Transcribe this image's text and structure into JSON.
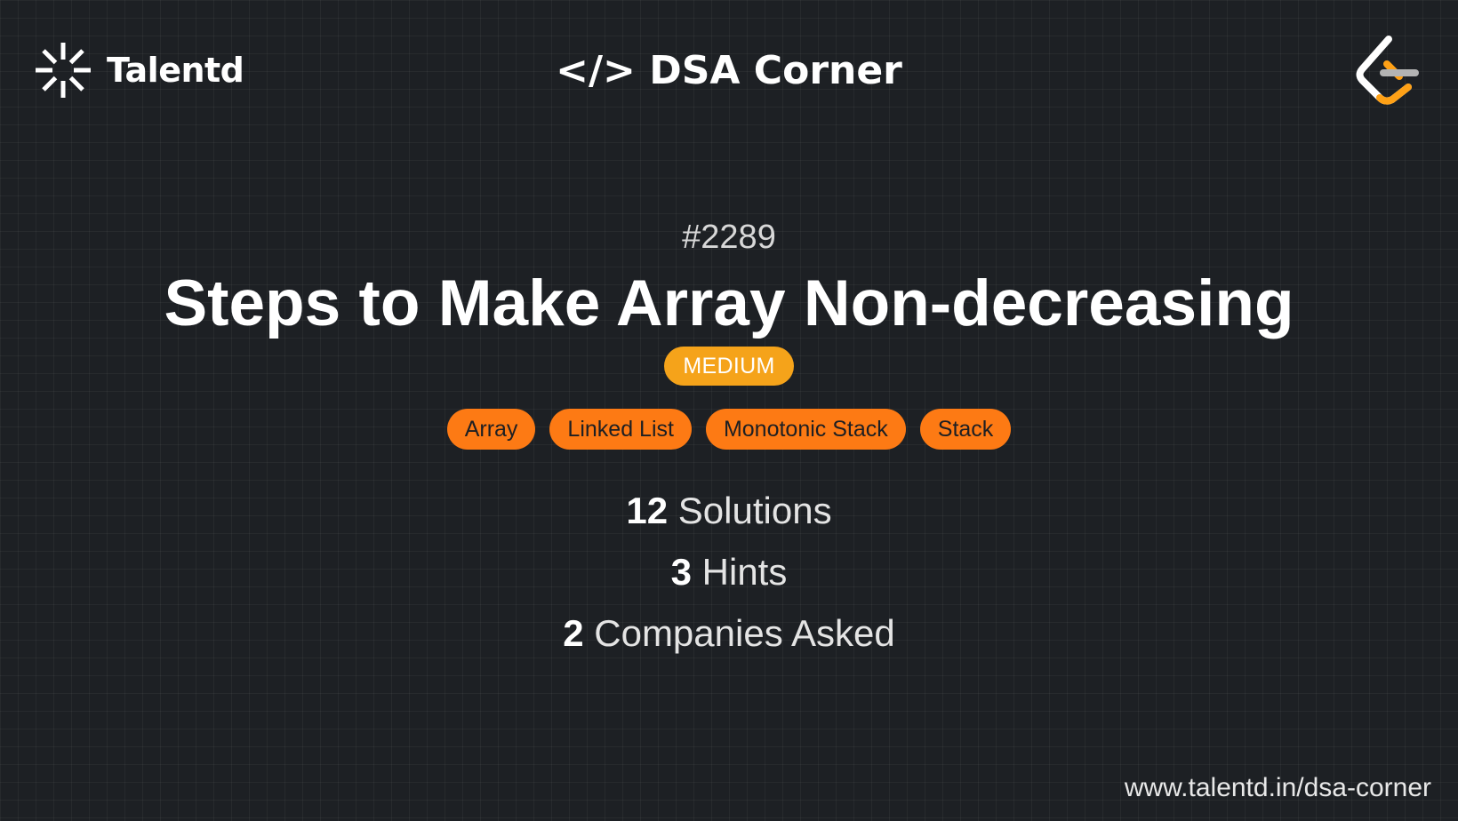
{
  "brand": {
    "name": "Talentd",
    "icon": "asterisk-burst-icon",
    "color": "#ffffff"
  },
  "header": {
    "section_title": "</> DSA Corner",
    "platform_icon": "leetcode-logo-icon"
  },
  "problem": {
    "number": "#2289",
    "title": "Steps to Make Array Non-decreasing",
    "difficulty": "MEDIUM",
    "difficulty_color": "#f5a31a",
    "tags": [
      "Array",
      "Linked List",
      "Monotonic Stack",
      "Stack"
    ],
    "tag_color": "#fd7a14"
  },
  "stats": {
    "solutions_count": "12",
    "solutions_label": "Solutions",
    "hints_count": "3",
    "hints_label": "Hints",
    "companies_count": "2",
    "companies_label": "Companies Asked"
  },
  "footer": {
    "url": "www.talentd.in/dsa-corner"
  },
  "colors": {
    "background": "#1d2024",
    "text": "#ffffff",
    "accent_orange": "#fd7a14",
    "accent_amber": "#f5a31a"
  }
}
